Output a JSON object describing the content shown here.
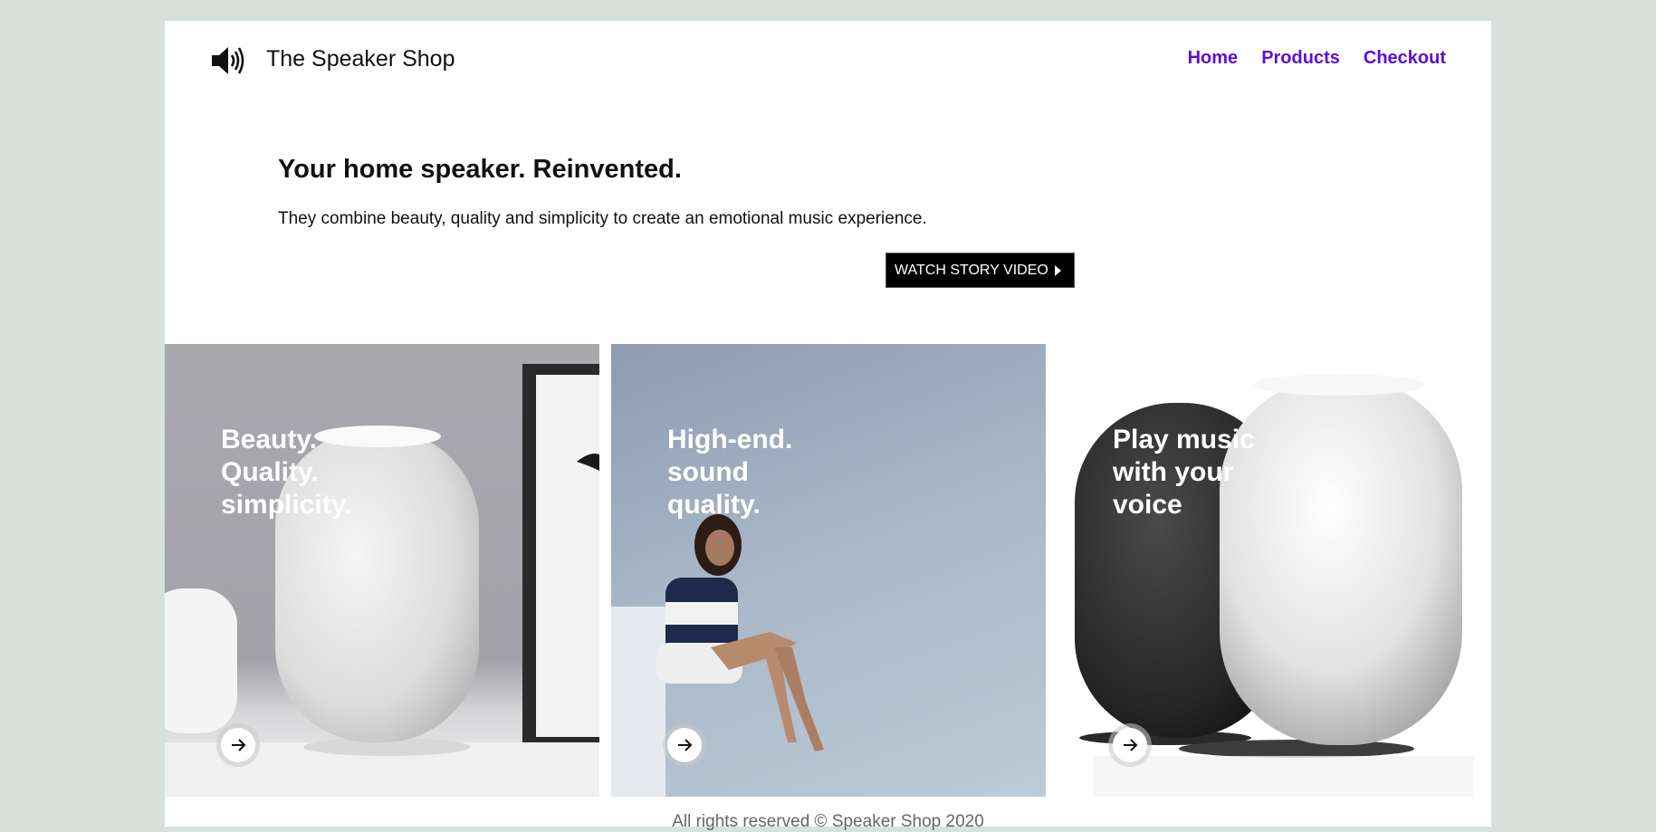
{
  "header": {
    "brand": "The Speaker Shop",
    "logo_icon": "speaker-volume-icon",
    "nav": [
      {
        "label": "Home"
      },
      {
        "label": "Products"
      },
      {
        "label": "Checkout"
      }
    ],
    "nav_color": "#5a0fd8"
  },
  "hero": {
    "title": "Your home speaker. Reinvented.",
    "subtitle": "They combine beauty, quality and simplicity to create an emotional music experience.",
    "cta_label": "WATCH STORY VIDEO",
    "cta_icon": "play-triangle-icon"
  },
  "cards": [
    {
      "lines": [
        "Beauty.",
        "Quality.",
        "simplicity."
      ],
      "arrow_icon": "arrow-right-icon"
    },
    {
      "lines": [
        "High-end.",
        "sound",
        "quality."
      ],
      "arrow_icon": "arrow-right-icon"
    },
    {
      "lines": [
        "Play music",
        "with your",
        "voice"
      ],
      "arrow_icon": "arrow-right-icon"
    }
  ],
  "footer": {
    "text": "All rights reserved © Speaker Shop 2020"
  },
  "colors": {
    "background": "#d9e0db",
    "page": "#ffffff",
    "button": "#000000"
  }
}
